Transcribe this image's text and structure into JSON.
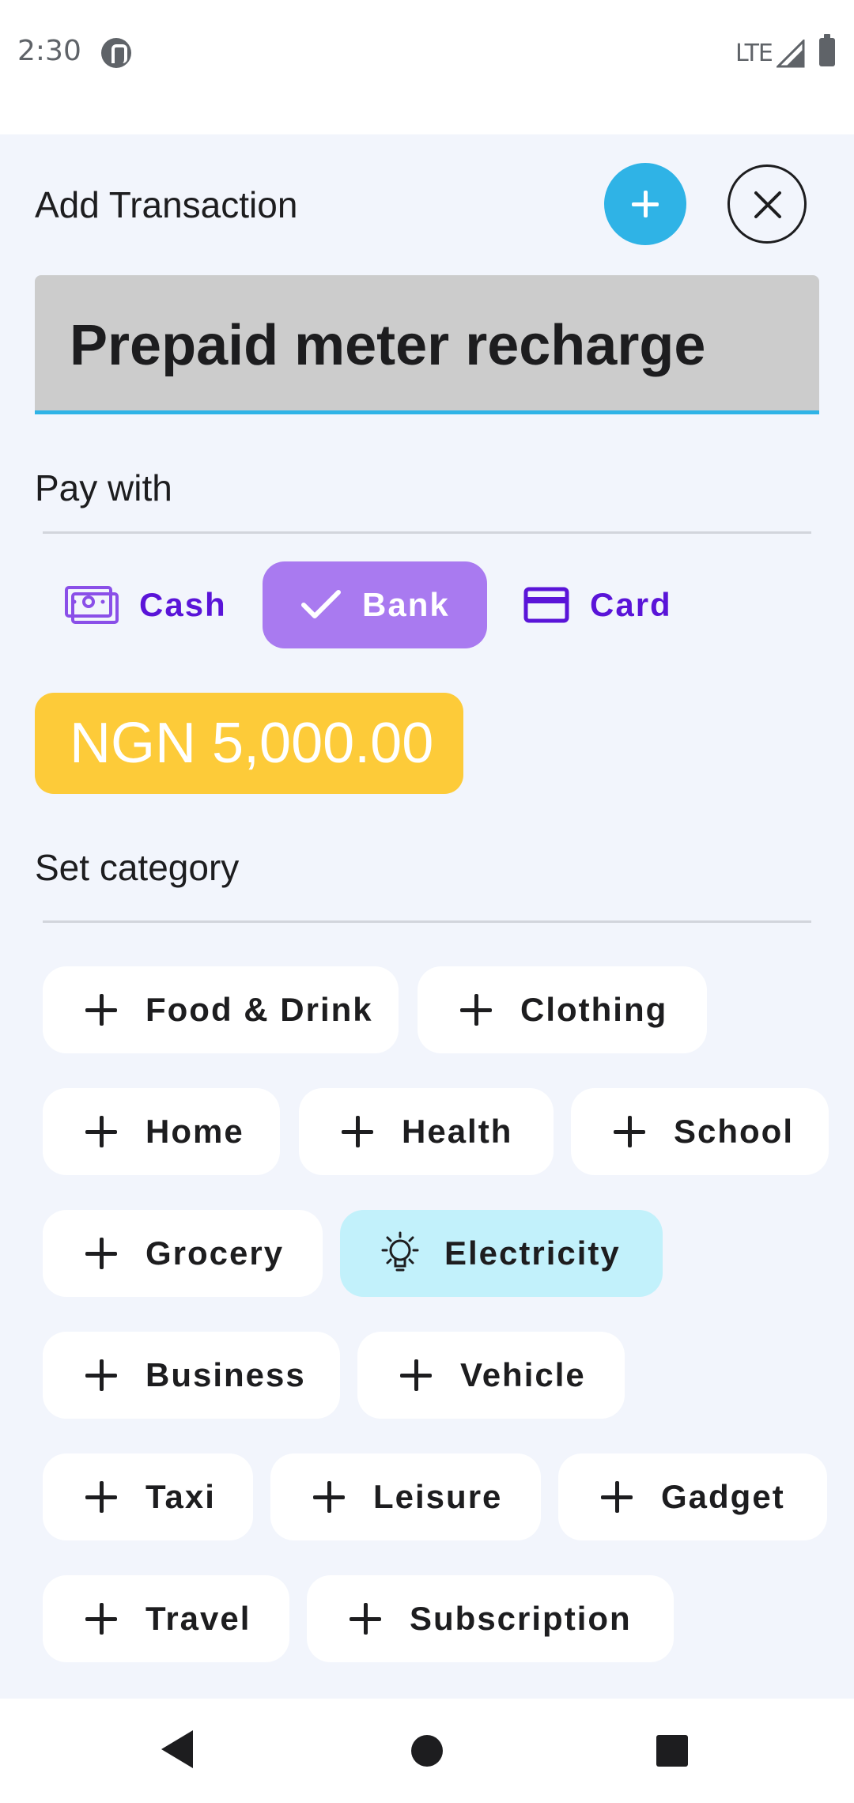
{
  "status_bar": {
    "time": "2:30",
    "network": "LTE"
  },
  "header": {
    "title": "Add Transaction",
    "add_icon": "plus-icon",
    "close_icon": "close-icon"
  },
  "transaction": {
    "title_value": "Prepaid meter recharge"
  },
  "payment": {
    "section_label": "Pay with",
    "options": [
      {
        "label": "Cash",
        "icon": "cash-icon",
        "selected": false
      },
      {
        "label": "Bank",
        "icon": "checkmark-icon",
        "selected": true
      },
      {
        "label": "Card",
        "icon": "credit-card-icon",
        "selected": false
      }
    ]
  },
  "amount": {
    "value": "NGN 5,000.00"
  },
  "category": {
    "section_label": "Set category",
    "chips": [
      {
        "label": "Food & Drink",
        "icon": "plus-icon",
        "selected": false
      },
      {
        "label": "Clothing",
        "icon": "plus-icon",
        "selected": false
      },
      {
        "label": "Home",
        "icon": "plus-icon",
        "selected": false
      },
      {
        "label": "Health",
        "icon": "plus-icon",
        "selected": false
      },
      {
        "label": "School",
        "icon": "plus-icon",
        "selected": false
      },
      {
        "label": "Grocery",
        "icon": "plus-icon",
        "selected": false
      },
      {
        "label": "Electricity",
        "icon": "lightbulb-icon",
        "selected": true
      },
      {
        "label": "Business",
        "icon": "plus-icon",
        "selected": false
      },
      {
        "label": "Vehicle",
        "icon": "plus-icon",
        "selected": false
      },
      {
        "label": "Taxi",
        "icon": "plus-icon",
        "selected": false
      },
      {
        "label": "Leisure",
        "icon": "plus-icon",
        "selected": false
      },
      {
        "label": "Gadget",
        "icon": "plus-icon",
        "selected": false
      },
      {
        "label": "Travel",
        "icon": "plus-icon",
        "selected": false
      },
      {
        "label": "Subscription",
        "icon": "plus-icon",
        "selected": false
      }
    ]
  },
  "colors": {
    "accent_blue": "#2fb3e6",
    "selected_payment": "#a97af0",
    "payment_text": "#5a14d8",
    "amount_chip": "#fdcb39",
    "selected_category": "#c2f1fb",
    "sheet_background": "#f2f5fc"
  },
  "nav_bar": {
    "back_icon": "back-triangle-icon",
    "home_icon": "home-circle-icon",
    "recents_icon": "recents-square-icon"
  }
}
